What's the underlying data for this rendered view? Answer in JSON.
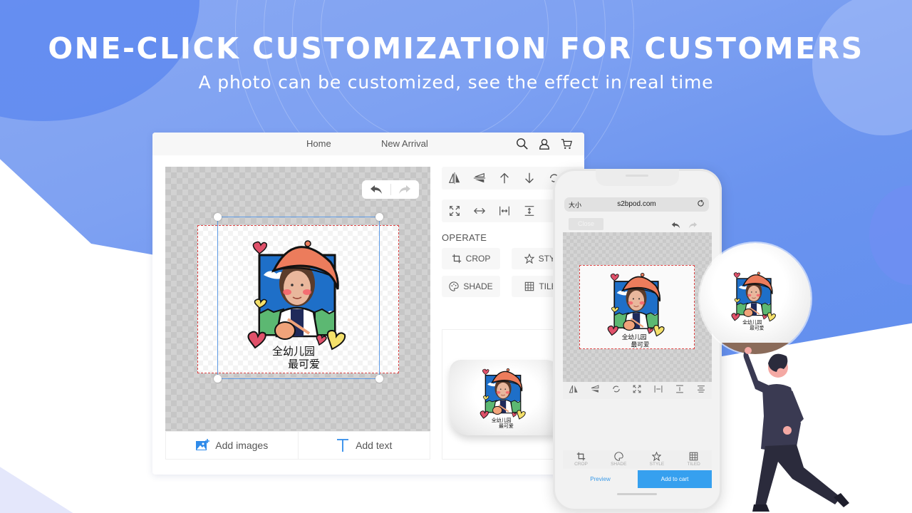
{
  "hero": {
    "title": "ONE-CLICK CUSTOMIZATION FOR CUSTOMERS",
    "subtitle": "A photo can be customized, see the effect in real time"
  },
  "desktop": {
    "nav": {
      "links": [
        "Home",
        "New Arrival"
      ],
      "icons": [
        "search-icon",
        "user-icon",
        "cart-icon"
      ]
    },
    "canvas": {
      "undo_icon": "undo-icon",
      "redo_icon": "redo-icon",
      "artwork_caption": "全幼儿园 最可爱"
    },
    "tools_row1": [
      "flip-horizontal-icon",
      "flip-vertical-icon",
      "arrow-up-icon",
      "arrow-down-icon",
      "rotate-icon"
    ],
    "tools_row2": [
      "fit-expand-icon",
      "stretch-horizontal-icon",
      "center-horizontal-icon",
      "center-vertical-icon"
    ],
    "operate": {
      "label": "OPERATE",
      "buttons": [
        {
          "label": "CROP",
          "icon": "crop-icon"
        },
        {
          "label": "STYLE",
          "icon": "star-icon"
        },
        {
          "label": "SHADE",
          "icon": "palette-icon"
        },
        {
          "label": "TILED",
          "icon": "grid-icon"
        }
      ],
      "visible_labels": [
        "CROP",
        "STYI",
        "SHADE",
        "TILE"
      ]
    },
    "actions": {
      "add_images": "Add images",
      "add_text": "Add text"
    }
  },
  "phone": {
    "url_prefix": "大小",
    "url": "s2bpod.com",
    "close_label": "Close",
    "toolbar_icons": [
      "flip-horizontal-icon",
      "flip-vertical-icon",
      "rotate-icon",
      "fit-expand-icon",
      "center-horizontal-icon",
      "center-vertical-icon",
      "align-icon"
    ],
    "bottom_tabs": [
      {
        "label": "CROP",
        "icon": "crop-icon"
      },
      {
        "label": "SHADE",
        "icon": "palette-icon"
      },
      {
        "label": "STYLE",
        "icon": "star-icon"
      },
      {
        "label": "TILED",
        "icon": "grid-icon"
      }
    ],
    "preview_label": "Preview",
    "add_to_cart_label": "Add to cart"
  },
  "colors": {
    "accent": "#36a0ef",
    "hero_blue": "#6b94ef",
    "selection_blue": "#5e9be6",
    "design_border": "#e04747",
    "hat": "#ec7c5c",
    "person": "#3a3a52"
  }
}
